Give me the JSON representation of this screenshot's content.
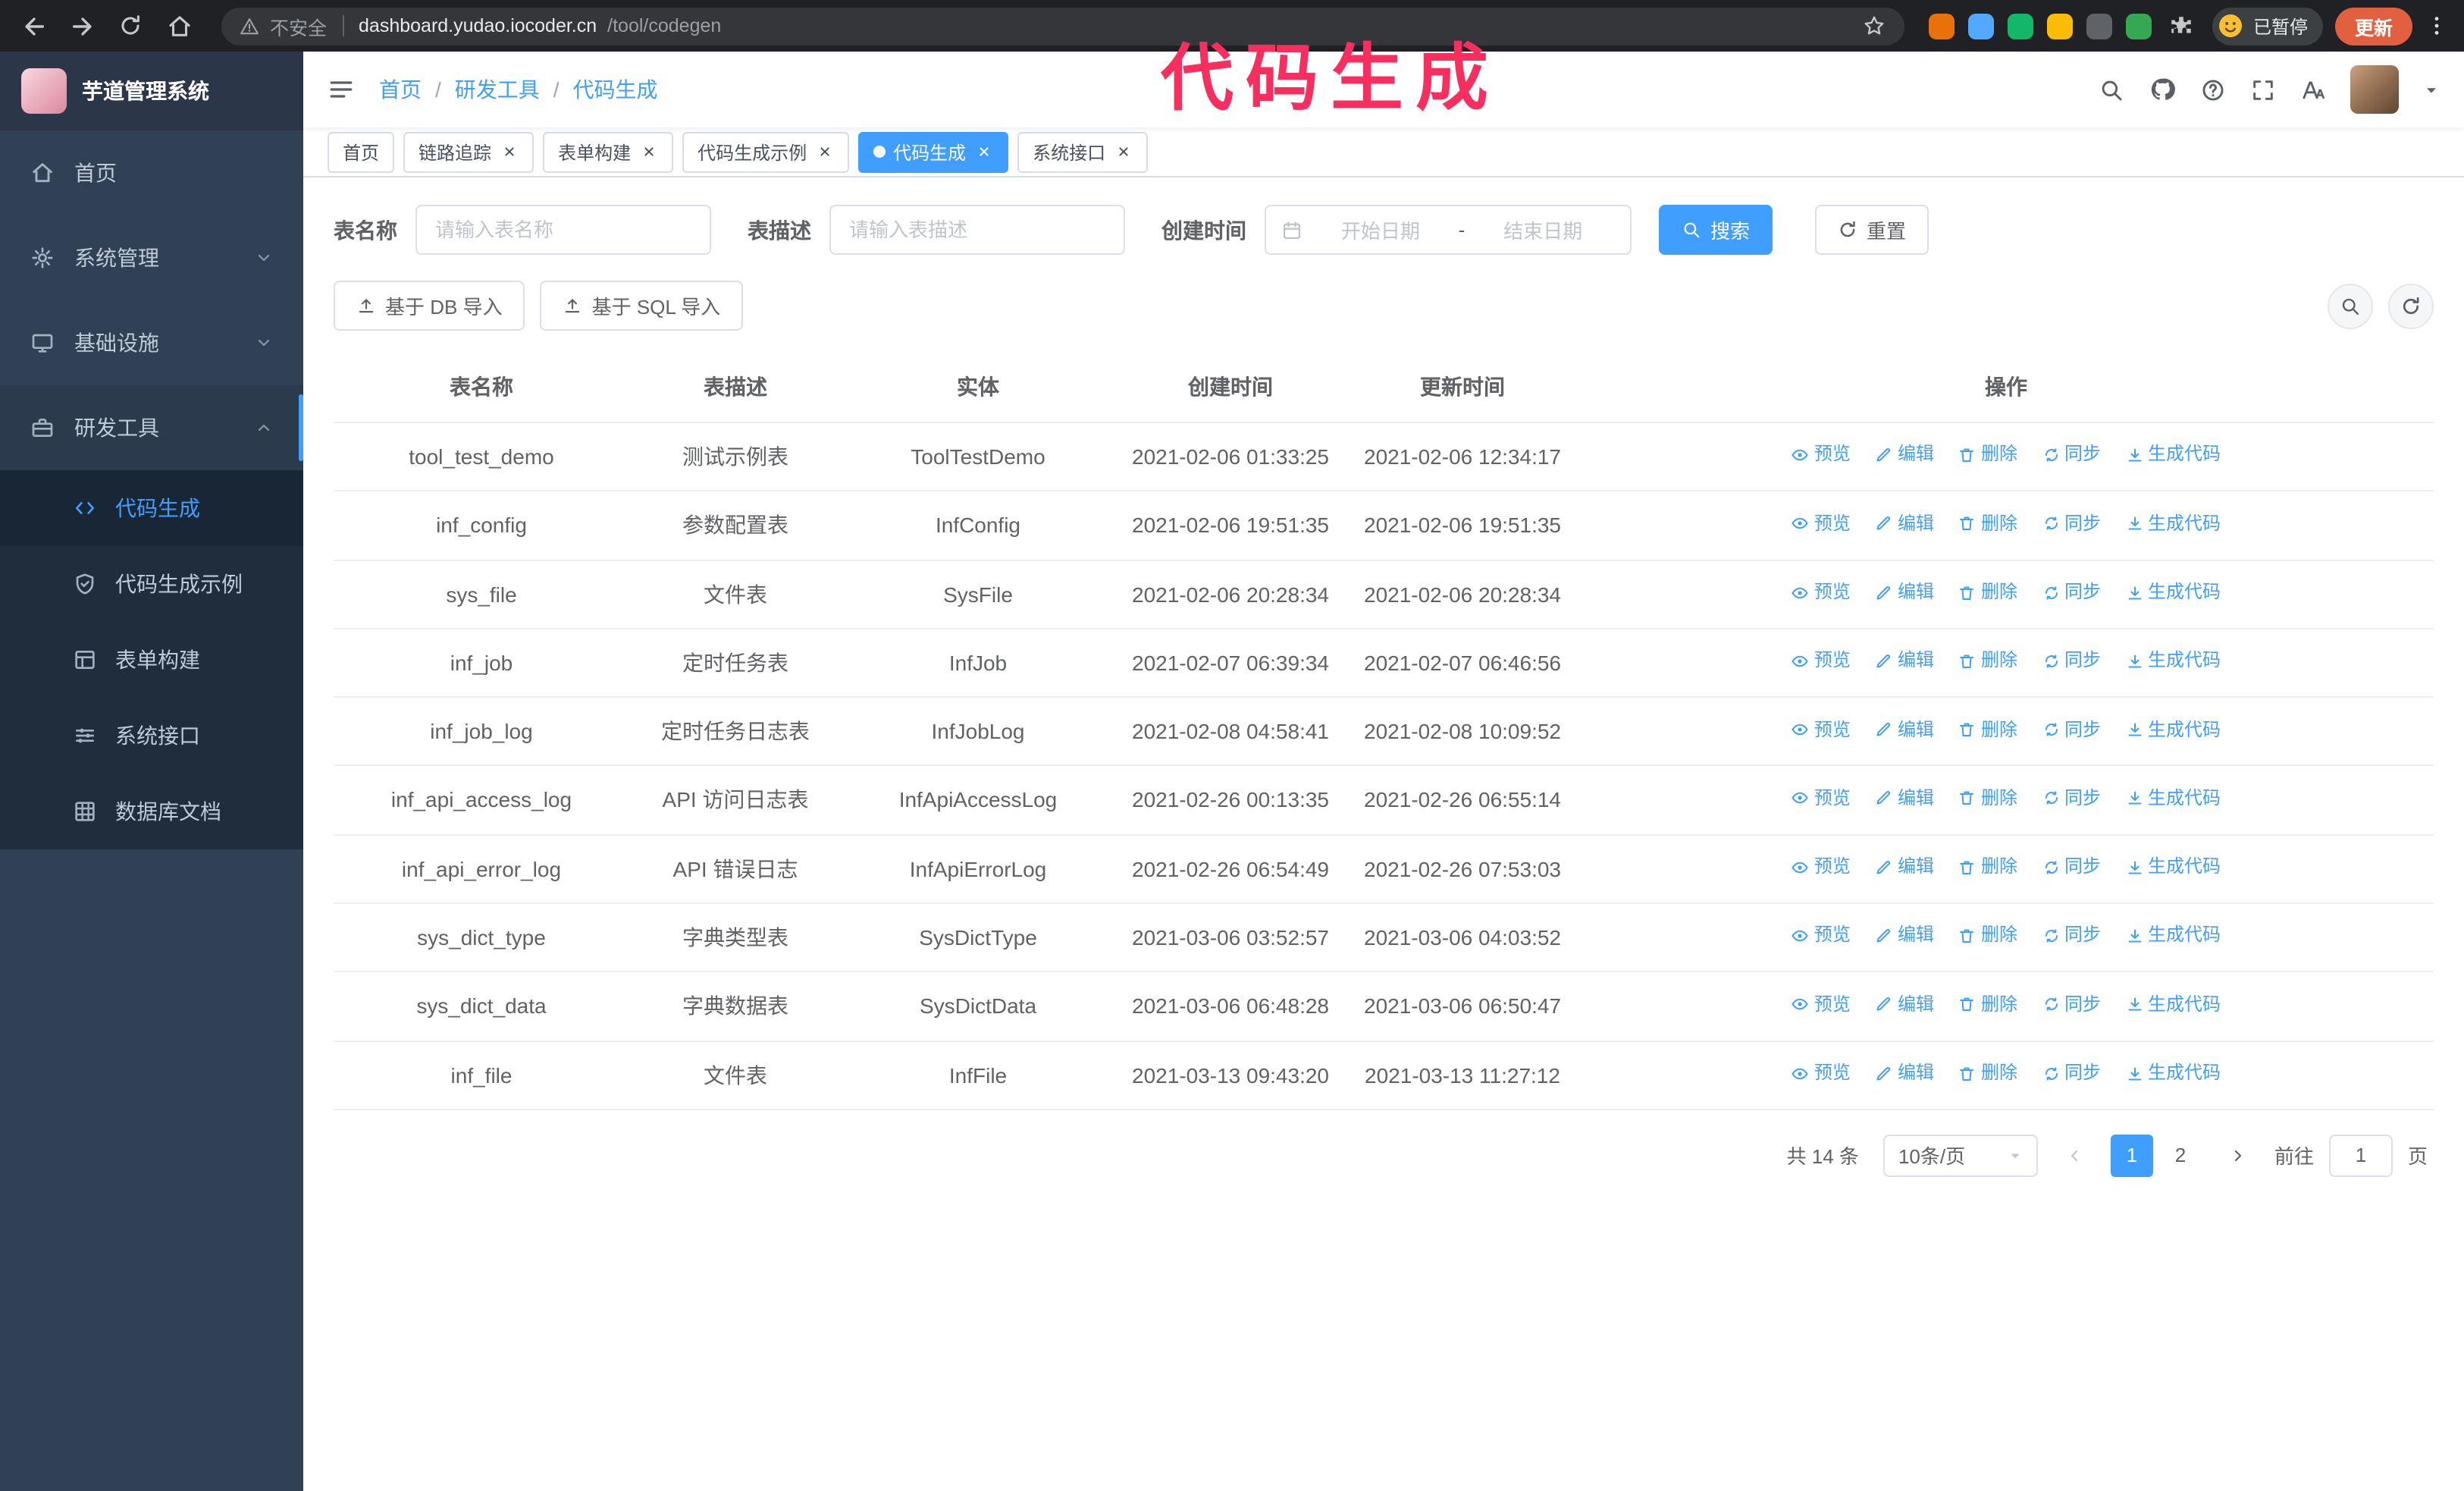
{
  "annotation": {
    "text": "代码生成",
    "color": "#f72e5e"
  },
  "browser": {
    "security_label": "不安全",
    "url_host": "dashboard.yudao.iocoder.cn",
    "url_path": "/tool/codegen",
    "profile_badge": "已暂停",
    "update_label": "更新",
    "extensions": [
      {
        "name": "fox-extension-icon",
        "color": "#e8710a"
      },
      {
        "name": "drop-extension-icon",
        "color": "#53a8ff"
      },
      {
        "name": "vpn-extension-icon",
        "color": "#12b76a"
      },
      {
        "name": "people-extension-icon",
        "color": "#fbbc04"
      },
      {
        "name": "dark-extension-icon",
        "color": "#5f6368"
      },
      {
        "name": "leaf-extension-icon",
        "color": "#34a853"
      }
    ]
  },
  "sidebar": {
    "logo_title": "芋道管理系统",
    "items": [
      {
        "label": "首页",
        "icon": "home-icon"
      },
      {
        "label": "系统管理",
        "icon": "gear-icon",
        "expandable": true
      },
      {
        "label": "基础设施",
        "icon": "monitor-icon",
        "expandable": true
      },
      {
        "label": "研发工具",
        "icon": "toolbox-icon",
        "expandable": true,
        "expanded": true,
        "children": [
          {
            "label": "代码生成",
            "icon": "code-icon",
            "active": true
          },
          {
            "label": "代码生成示例",
            "icon": "shield-check-icon"
          },
          {
            "label": "表单构建",
            "icon": "form-icon"
          },
          {
            "label": "系统接口",
            "icon": "sliders-icon"
          },
          {
            "label": "数据库文档",
            "icon": "table-grid-icon"
          }
        ]
      }
    ]
  },
  "header": {
    "breadcrumb": [
      "首页",
      "研发工具",
      "代码生成"
    ]
  },
  "tabs": [
    {
      "label": "首页",
      "closable": false,
      "active": false
    },
    {
      "label": "链路追踪",
      "closable": true,
      "active": false
    },
    {
      "label": "表单构建",
      "closable": true,
      "active": false
    },
    {
      "label": "代码生成示例",
      "closable": true,
      "active": false
    },
    {
      "label": "代码生成",
      "closable": true,
      "active": true
    },
    {
      "label": "系统接口",
      "closable": true,
      "active": false
    }
  ],
  "filters": {
    "name_label": "表名称",
    "name_placeholder": "请输入表名称",
    "desc_label": "表描述",
    "desc_placeholder": "请输入表描述",
    "time_label": "创建时间",
    "start_placeholder": "开始日期",
    "separator": "-",
    "end_placeholder": "结束日期",
    "search_label": "搜索",
    "reset_label": "重置"
  },
  "toolbar": {
    "import_db_label": "基于 DB 导入",
    "import_sql_label": "基于 SQL 导入"
  },
  "table": {
    "headers": [
      "表名称",
      "表描述",
      "实体",
      "创建时间",
      "更新时间",
      "操作"
    ],
    "action_labels": [
      "预览",
      "编辑",
      "删除",
      "同步",
      "生成代码"
    ],
    "action_icons": [
      "eye-icon",
      "edit-icon",
      "trash-icon",
      "sync-icon",
      "download-icon"
    ],
    "action_names": [
      "preview-link",
      "edit-link",
      "delete-link",
      "sync-link",
      "generate-code-link"
    ],
    "rows": [
      {
        "name": "tool_test_demo",
        "description": "测试示例表",
        "entity": "ToolTestDemo",
        "create_time": "2021-02-06 01:33:25",
        "update_time": "2021-02-06 12:34:17"
      },
      {
        "name": "inf_config",
        "description": "参数配置表",
        "entity": "InfConfig",
        "create_time": "2021-02-06 19:51:35",
        "update_time": "2021-02-06 19:51:35"
      },
      {
        "name": "sys_file",
        "description": "文件表",
        "entity": "SysFile",
        "create_time": "2021-02-06 20:28:34",
        "update_time": "2021-02-06 20:28:34"
      },
      {
        "name": "inf_job",
        "description": "定时任务表",
        "entity": "InfJob",
        "create_time": "2021-02-07 06:39:34",
        "update_time": "2021-02-07 06:46:56"
      },
      {
        "name": "inf_job_log",
        "description": "定时任务日志表",
        "entity": "InfJobLog",
        "create_time": "2021-02-08 04:58:41",
        "update_time": "2021-02-08 10:09:52"
      },
      {
        "name": "inf_api_access_log",
        "description": "API 访问日志表",
        "entity": "InfApiAccessLog",
        "create_time": "2021-02-26 00:13:35",
        "update_time": "2021-02-26 06:55:14"
      },
      {
        "name": "inf_api_error_log",
        "description": "API 错误日志",
        "entity": "InfApiErrorLog",
        "create_time": "2021-02-26 06:54:49",
        "update_time": "2021-02-26 07:53:03"
      },
      {
        "name": "sys_dict_type",
        "description": "字典类型表",
        "entity": "SysDictType",
        "create_time": "2021-03-06 03:52:57",
        "update_time": "2021-03-06 04:03:52"
      },
      {
        "name": "sys_dict_data",
        "description": "字典数据表",
        "entity": "SysDictData",
        "create_time": "2021-03-06 06:48:28",
        "update_time": "2021-03-06 06:50:47"
      },
      {
        "name": "inf_file",
        "description": "文件表",
        "entity": "InfFile",
        "create_time": "2021-03-13 09:43:20",
        "update_time": "2021-03-13 11:27:12"
      }
    ]
  },
  "pagination": {
    "total": "共 14 条",
    "page_size": "10条/页",
    "pages": [
      "1",
      "2"
    ],
    "active_page": "1",
    "goto_label": "前往",
    "goto_value": "1",
    "goto_suffix": "页"
  },
  "colors": {
    "accent": "#409eff",
    "sidebar_bg": "#304156",
    "submenu_bg": "#1f2d3d",
    "update_button": "#e2603f"
  }
}
